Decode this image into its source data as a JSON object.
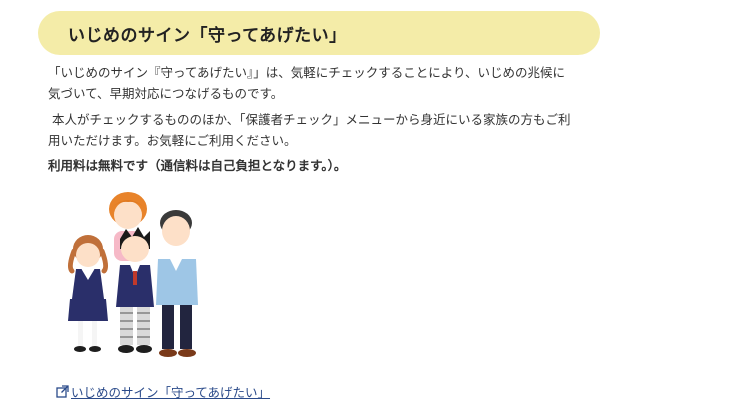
{
  "section": {
    "heading": "いじめのサイン「守ってあげたい」"
  },
  "body": {
    "paragraph1_line1": "「いじめのサイン『守ってあげたい』」は、気軽にチェックすることにより、いじめの兆候に",
    "paragraph1_line2": "気づいて、早期対応につなげるものです。",
    "paragraph2_line1": "本人がチェックするもののほか、「保護者チェック」メニューから身近にいる家族の方もご利",
    "paragraph2_line2": "用いただけます。お気軽にご利用ください。",
    "fee_note": "利用料は無料です（通信料は自己負担となります。）。"
  },
  "link": {
    "label": "いじめのサイン「守ってあげたい」",
    "icon": "external-link-icon"
  },
  "colors": {
    "heading_bg": "#f4eca8",
    "link": "#2a4a8a"
  }
}
